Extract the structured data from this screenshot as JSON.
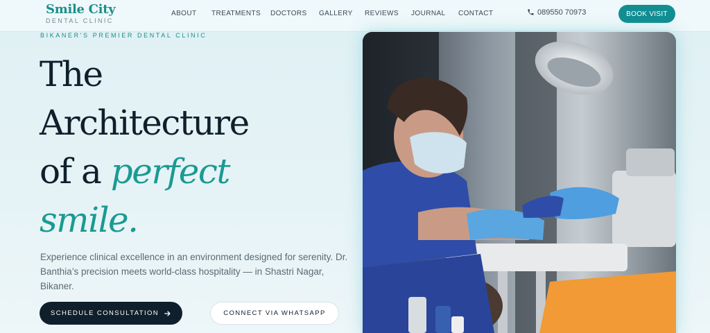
{
  "brand": {
    "name": "Smile City",
    "tagline": "DENTAL CLINIC"
  },
  "nav": {
    "items": [
      "ABOUT",
      "TREATMENTS",
      "DOCTORS",
      "GALLERY",
      "REVIEWS",
      "JOURNAL",
      "CONTACT"
    ],
    "phone": "089550 70973",
    "cta": "BOOK VISIT"
  },
  "hero": {
    "kicker": "BIKANER'S PREMIER DENTAL CLINIC",
    "headline_line1": "The",
    "headline_line2": "Architecture",
    "headline_line3_plain": "of a ",
    "headline_line3_accent": "perfect",
    "headline_line4_accent": "smile.",
    "description": "Experience clinical excellence in an environment designed for serenity. Dr. Banthia’s precision meets world-class hospitality — in Shastri Nagar, Bikaner.",
    "primary_button": "SCHEDULE CONSULTATION",
    "secondary_button": "CONNECT VIA WHATSAPP"
  },
  "colors": {
    "accent": "#1a8f8a",
    "dark": "#0f1f2b",
    "background": "#e2f1f5"
  },
  "icons": {
    "phone": "phone-icon",
    "arrow": "arrow-right-icon"
  }
}
